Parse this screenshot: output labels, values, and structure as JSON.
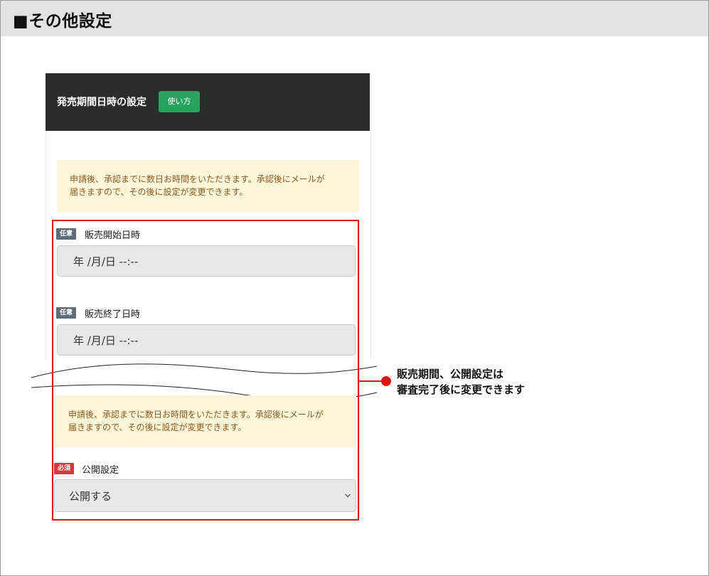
{
  "section": {
    "title": "■その他設定"
  },
  "panel": {
    "title": "発売期間日時の設定",
    "howto_button": "使い方"
  },
  "notice": {
    "line1": "申請後、承認までに数日お時間をいただきます。承認後にメールが",
    "line2": "届きますので、その後に設定が変更できます。"
  },
  "fields": {
    "start": {
      "badge": "任意",
      "label": "販売開始日時",
      "value": "年 /月/日 --:--"
    },
    "end": {
      "badge": "任意",
      "label": "販売終了日時",
      "value": "年 /月/日 --:--"
    },
    "publish": {
      "badge": "必須",
      "label": "公開設定",
      "value": "公開する"
    }
  },
  "callout": {
    "line1": "販売期間、公開設定は",
    "line2": "審査完了後に変更できます"
  },
  "colors": {
    "header_bg": "#2c2c2c",
    "button_green": "#27a35e",
    "notice_bg": "#fdf5d9",
    "notice_text": "#8a5a22",
    "badge_optional": "#5f6b76",
    "badge_required": "#d9363e",
    "highlight_red": "#e01515"
  },
  "icons": {
    "select_arrow": "chevron-down-icon",
    "callout_dot": "callout-dot-icon"
  }
}
